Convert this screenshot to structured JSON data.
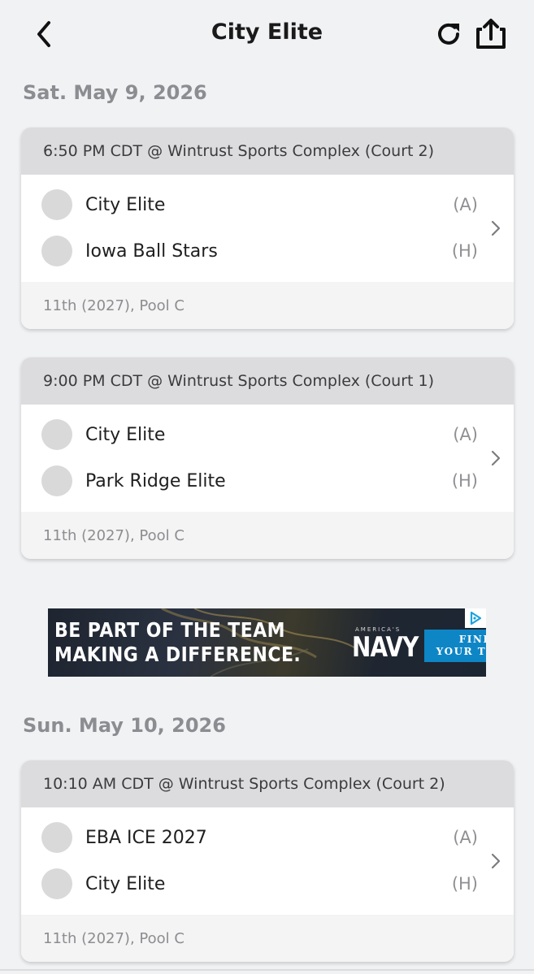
{
  "header": {
    "title": "City Elite",
    "back_icon": "chevron-left-icon",
    "refresh_icon": "refresh-icon",
    "share_icon": "share-icon"
  },
  "days": [
    {
      "label": "Sat. May 9, 2026",
      "games": [
        {
          "time_location": "6:50 PM CDT @ Wintrust Sports Complex (Court 2)",
          "teams": [
            {
              "name": "City Elite",
              "side": "(A)"
            },
            {
              "name": "Iowa Ball Stars",
              "side": "(H)"
            }
          ],
          "division": "11th (2027), Pool C"
        },
        {
          "time_location": "9:00 PM CDT @ Wintrust Sports Complex (Court 1)",
          "teams": [
            {
              "name": "City Elite",
              "side": "(A)"
            },
            {
              "name": "Park Ridge Elite",
              "side": "(H)"
            }
          ],
          "division": "11th (2027), Pool C"
        }
      ]
    },
    {
      "label": "Sun. May 10, 2026",
      "games": [
        {
          "time_location": "10:10 AM CDT @ Wintrust Sports Complex (Court 2)",
          "teams": [
            {
              "name": "EBA ICE 2027",
              "side": "(A)"
            },
            {
              "name": "City Elite",
              "side": "(H)"
            }
          ],
          "division": "11th (2027), Pool C"
        }
      ]
    }
  ],
  "ad": {
    "line1": "BE PART OF THE TEAM",
    "line2": "MAKING A DIFFERENCE.",
    "brand_small": "AMERICA'S",
    "brand": "NAVY",
    "cta_line1": "FIND",
    "cta_line2": "YOUR TEAM"
  },
  "colors": {
    "background": "#f1f2f4",
    "card_header": "#dcdcde",
    "ad_cta": "#0e86c6"
  }
}
